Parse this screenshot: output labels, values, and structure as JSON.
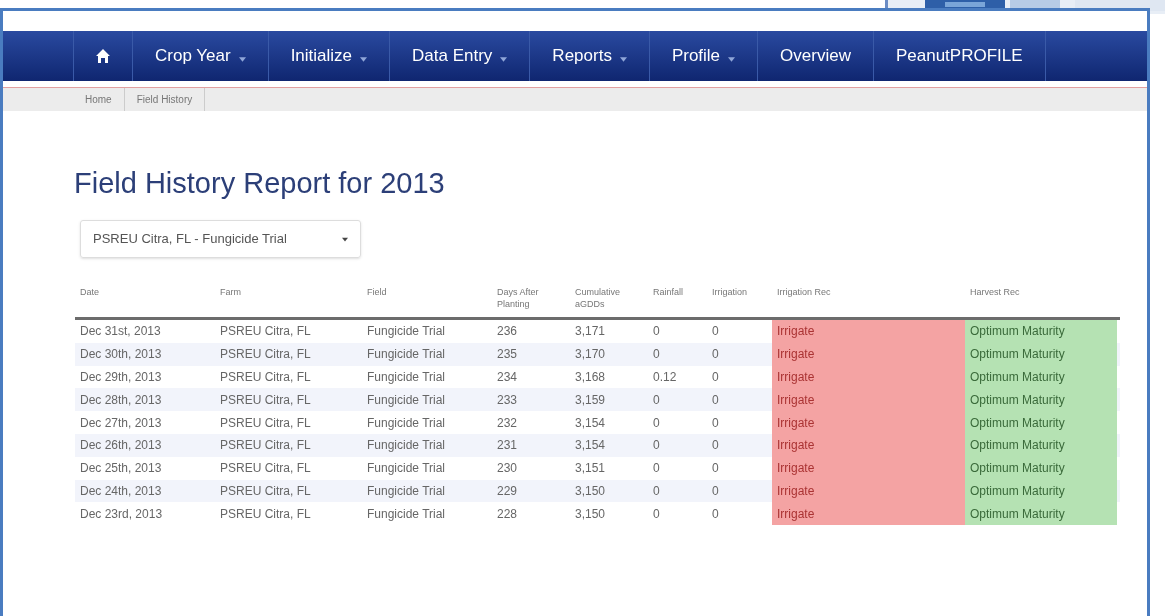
{
  "nav": {
    "items": [
      {
        "label": "Crop Year",
        "has_menu": true
      },
      {
        "label": "Initialize",
        "has_menu": true
      },
      {
        "label": "Data Entry",
        "has_menu": true
      },
      {
        "label": "Reports",
        "has_menu": true
      },
      {
        "label": "Profile",
        "has_menu": true
      },
      {
        "label": "Overview",
        "has_menu": false
      },
      {
        "label": "PeanutPROFILE",
        "has_menu": false
      }
    ]
  },
  "breadcrumb": [
    "Home",
    "Field History"
  ],
  "title": "Field History Report for 2013",
  "field_select": {
    "value": "PSREU Citra, FL - Fungicide Trial"
  },
  "table": {
    "columns": [
      [
        "Date"
      ],
      [
        "Farm"
      ],
      [
        "Field"
      ],
      [
        "Days After",
        "Planting"
      ],
      [
        "Cumulative",
        "aGDDs"
      ],
      [
        "Rainfall"
      ],
      [
        "Irrigation"
      ],
      [
        "Irrigation Rec"
      ],
      [
        "Harvest Rec"
      ]
    ],
    "rows": [
      {
        "date": "Dec 31st, 2013",
        "farm": "PSREU Citra, FL",
        "field": "Fungicide Trial",
        "days": "236",
        "gdds": "3,171",
        "rainfall": "0",
        "irrigation": "0",
        "irrigation_rec": {
          "text": "Irrigate",
          "color": "#f4a3a3"
        },
        "harvest_rec": {
          "text": "Optimum Maturity",
          "color": "#b5e2b3"
        }
      },
      {
        "date": "Dec 30th, 2013",
        "farm": "PSREU Citra, FL",
        "field": "Fungicide Trial",
        "days": "235",
        "gdds": "3,170",
        "rainfall": "0",
        "irrigation": "0",
        "irrigation_rec": {
          "text": "Irrigate",
          "color": "#f4a3a3"
        },
        "harvest_rec": {
          "text": "Optimum Maturity",
          "color": "#b5e2b3"
        }
      },
      {
        "date": "Dec 29th, 2013",
        "farm": "PSREU Citra, FL",
        "field": "Fungicide Trial",
        "days": "234",
        "gdds": "3,168",
        "rainfall": "0.12",
        "irrigation": "0",
        "irrigation_rec": {
          "text": "Irrigate",
          "color": "#f4a3a3"
        },
        "harvest_rec": {
          "text": "Optimum Maturity",
          "color": "#b5e2b3"
        }
      },
      {
        "date": "Dec 28th, 2013",
        "farm": "PSREU Citra, FL",
        "field": "Fungicide Trial",
        "days": "233",
        "gdds": "3,159",
        "rainfall": "0",
        "irrigation": "0",
        "irrigation_rec": {
          "text": "Irrigate",
          "color": "#f4a3a3"
        },
        "harvest_rec": {
          "text": "Optimum Maturity",
          "color": "#b5e2b3"
        }
      },
      {
        "date": "Dec 27th, 2013",
        "farm": "PSREU Citra, FL",
        "field": "Fungicide Trial",
        "days": "232",
        "gdds": "3,154",
        "rainfall": "0",
        "irrigation": "0",
        "irrigation_rec": {
          "text": "Irrigate",
          "color": "#f4a3a3"
        },
        "harvest_rec": {
          "text": "Optimum Maturity",
          "color": "#b5e2b3"
        }
      },
      {
        "date": "Dec 26th, 2013",
        "farm": "PSREU Citra, FL",
        "field": "Fungicide Trial",
        "days": "231",
        "gdds": "3,154",
        "rainfall": "0",
        "irrigation": "0",
        "irrigation_rec": {
          "text": "Irrigate",
          "color": "#f4a3a3"
        },
        "harvest_rec": {
          "text": "Optimum Maturity",
          "color": "#b5e2b3"
        }
      },
      {
        "date": "Dec 25th, 2013",
        "farm": "PSREU Citra, FL",
        "field": "Fungicide Trial",
        "days": "230",
        "gdds": "3,151",
        "rainfall": "0",
        "irrigation": "0",
        "irrigation_rec": {
          "text": "Irrigate",
          "color": "#f4a3a3"
        },
        "harvest_rec": {
          "text": "Optimum Maturity",
          "color": "#b5e2b3"
        }
      },
      {
        "date": "Dec 24th, 2013",
        "farm": "PSREU Citra, FL",
        "field": "Fungicide Trial",
        "days": "229",
        "gdds": "3,150",
        "rainfall": "0",
        "irrigation": "0",
        "irrigation_rec": {
          "text": "Irrigate",
          "color": "#f4a3a3"
        },
        "harvest_rec": {
          "text": "Optimum Maturity",
          "color": "#b5e2b3"
        }
      },
      {
        "date": "Dec 23rd, 2013",
        "farm": "PSREU Citra, FL",
        "field": "Fungicide Trial",
        "days": "228",
        "gdds": "3,150",
        "rainfall": "0",
        "irrigation": "0",
        "irrigation_rec": {
          "text": "Irrigate",
          "color": "#f4a3a3"
        },
        "harvest_rec": {
          "text": "Optimum Maturity",
          "color": "#b5e2b3"
        }
      }
    ]
  }
}
